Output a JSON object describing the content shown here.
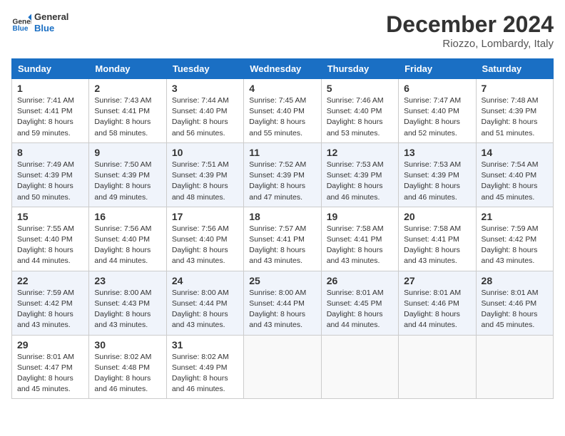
{
  "header": {
    "logo": {
      "general": "General",
      "blue": "Blue"
    },
    "title": "December 2024",
    "subtitle": "Riozzo, Lombardy, Italy"
  },
  "days_of_week": [
    "Sunday",
    "Monday",
    "Tuesday",
    "Wednesday",
    "Thursday",
    "Friday",
    "Saturday"
  ],
  "weeks": [
    [
      {
        "day": "1",
        "sunrise": "7:41 AM",
        "sunset": "4:41 PM",
        "daylight": "8 hours and 59 minutes."
      },
      {
        "day": "2",
        "sunrise": "7:43 AM",
        "sunset": "4:41 PM",
        "daylight": "8 hours and 58 minutes."
      },
      {
        "day": "3",
        "sunrise": "7:44 AM",
        "sunset": "4:40 PM",
        "daylight": "8 hours and 56 minutes."
      },
      {
        "day": "4",
        "sunrise": "7:45 AM",
        "sunset": "4:40 PM",
        "daylight": "8 hours and 55 minutes."
      },
      {
        "day": "5",
        "sunrise": "7:46 AM",
        "sunset": "4:40 PM",
        "daylight": "8 hours and 53 minutes."
      },
      {
        "day": "6",
        "sunrise": "7:47 AM",
        "sunset": "4:40 PM",
        "daylight": "8 hours and 52 minutes."
      },
      {
        "day": "7",
        "sunrise": "7:48 AM",
        "sunset": "4:39 PM",
        "daylight": "8 hours and 51 minutes."
      }
    ],
    [
      {
        "day": "8",
        "sunrise": "7:49 AM",
        "sunset": "4:39 PM",
        "daylight": "8 hours and 50 minutes."
      },
      {
        "day": "9",
        "sunrise": "7:50 AM",
        "sunset": "4:39 PM",
        "daylight": "8 hours and 49 minutes."
      },
      {
        "day": "10",
        "sunrise": "7:51 AM",
        "sunset": "4:39 PM",
        "daylight": "8 hours and 48 minutes."
      },
      {
        "day": "11",
        "sunrise": "7:52 AM",
        "sunset": "4:39 PM",
        "daylight": "8 hours and 47 minutes."
      },
      {
        "day": "12",
        "sunrise": "7:53 AM",
        "sunset": "4:39 PM",
        "daylight": "8 hours and 46 minutes."
      },
      {
        "day": "13",
        "sunrise": "7:53 AM",
        "sunset": "4:39 PM",
        "daylight": "8 hours and 46 minutes."
      },
      {
        "day": "14",
        "sunrise": "7:54 AM",
        "sunset": "4:40 PM",
        "daylight": "8 hours and 45 minutes."
      }
    ],
    [
      {
        "day": "15",
        "sunrise": "7:55 AM",
        "sunset": "4:40 PM",
        "daylight": "8 hours and 44 minutes."
      },
      {
        "day": "16",
        "sunrise": "7:56 AM",
        "sunset": "4:40 PM",
        "daylight": "8 hours and 44 minutes."
      },
      {
        "day": "17",
        "sunrise": "7:56 AM",
        "sunset": "4:40 PM",
        "daylight": "8 hours and 43 minutes."
      },
      {
        "day": "18",
        "sunrise": "7:57 AM",
        "sunset": "4:41 PM",
        "daylight": "8 hours and 43 minutes."
      },
      {
        "day": "19",
        "sunrise": "7:58 AM",
        "sunset": "4:41 PM",
        "daylight": "8 hours and 43 minutes."
      },
      {
        "day": "20",
        "sunrise": "7:58 AM",
        "sunset": "4:41 PM",
        "daylight": "8 hours and 43 minutes."
      },
      {
        "day": "21",
        "sunrise": "7:59 AM",
        "sunset": "4:42 PM",
        "daylight": "8 hours and 43 minutes."
      }
    ],
    [
      {
        "day": "22",
        "sunrise": "7:59 AM",
        "sunset": "4:42 PM",
        "daylight": "8 hours and 43 minutes."
      },
      {
        "day": "23",
        "sunrise": "8:00 AM",
        "sunset": "4:43 PM",
        "daylight": "8 hours and 43 minutes."
      },
      {
        "day": "24",
        "sunrise": "8:00 AM",
        "sunset": "4:44 PM",
        "daylight": "8 hours and 43 minutes."
      },
      {
        "day": "25",
        "sunrise": "8:00 AM",
        "sunset": "4:44 PM",
        "daylight": "8 hours and 43 minutes."
      },
      {
        "day": "26",
        "sunrise": "8:01 AM",
        "sunset": "4:45 PM",
        "daylight": "8 hours and 44 minutes."
      },
      {
        "day": "27",
        "sunrise": "8:01 AM",
        "sunset": "4:46 PM",
        "daylight": "8 hours and 44 minutes."
      },
      {
        "day": "28",
        "sunrise": "8:01 AM",
        "sunset": "4:46 PM",
        "daylight": "8 hours and 45 minutes."
      }
    ],
    [
      {
        "day": "29",
        "sunrise": "8:01 AM",
        "sunset": "4:47 PM",
        "daylight": "8 hours and 45 minutes."
      },
      {
        "day": "30",
        "sunrise": "8:02 AM",
        "sunset": "4:48 PM",
        "daylight": "8 hours and 46 minutes."
      },
      {
        "day": "31",
        "sunrise": "8:02 AM",
        "sunset": "4:49 PM",
        "daylight": "8 hours and 46 minutes."
      },
      null,
      null,
      null,
      null
    ]
  ],
  "labels": {
    "sunrise": "Sunrise:",
    "sunset": "Sunset:",
    "daylight": "Daylight:"
  }
}
